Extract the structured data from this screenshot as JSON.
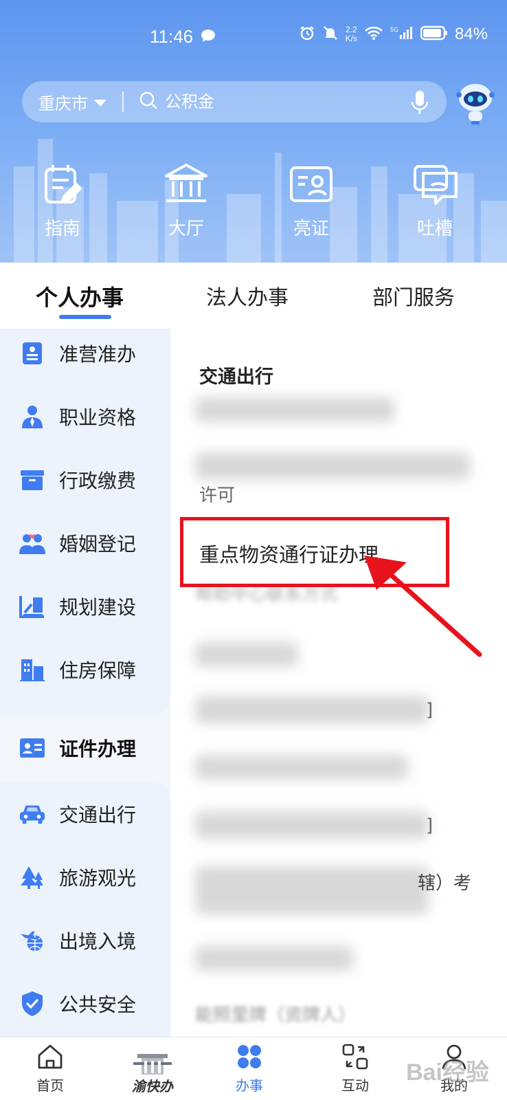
{
  "status_bar": {
    "time": "11:46",
    "net_speed_top": "2.2",
    "net_speed_unit": "K/s",
    "signal": "5G",
    "battery": "84%"
  },
  "search": {
    "city": "重庆市",
    "placeholder": "公积金"
  },
  "quick_actions": [
    {
      "label": "指南",
      "icon": "guide-icon"
    },
    {
      "label": "大厅",
      "icon": "hall-icon"
    },
    {
      "label": "亮证",
      "icon": "id-card-icon"
    },
    {
      "label": "吐槽",
      "icon": "feedback-icon"
    }
  ],
  "tabs": [
    {
      "label": "个人办事",
      "active": true
    },
    {
      "label": "法人办事",
      "active": false
    },
    {
      "label": "部门服务",
      "active": false
    }
  ],
  "left_nav": [
    {
      "label": "准营准办",
      "icon": "license-icon"
    },
    {
      "label": "职业资格",
      "icon": "professional-icon"
    },
    {
      "label": "行政缴费",
      "icon": "payment-box-icon"
    },
    {
      "label": "婚姻登记",
      "icon": "marriage-icon"
    },
    {
      "label": "规划建设",
      "icon": "planning-icon"
    },
    {
      "label": "住房保障",
      "icon": "housing-icon"
    },
    {
      "label": "证件办理",
      "icon": "certificate-icon",
      "active": true
    },
    {
      "label": "交通出行",
      "icon": "car-icon"
    },
    {
      "label": "旅游观光",
      "icon": "tree-icon"
    },
    {
      "label": "出境入境",
      "icon": "plane-globe-icon"
    },
    {
      "label": "公共安全",
      "icon": "shield-icon"
    }
  ],
  "content": {
    "category_title": "交通出行",
    "visible_fragments": [
      "许可",
      "帮助中心联系方式",
      "]",
      "]",
      "辖）考",
      "能照里牌（资牌人）"
    ],
    "highlighted_service": "重点物资通行证办理"
  },
  "bottom_nav": [
    {
      "label": "首页",
      "icon": "home-icon"
    },
    {
      "label": "渝快办",
      "icon": "yukuaiban-logo"
    },
    {
      "label": "办事",
      "icon": "grid-icon",
      "active": true
    },
    {
      "label": "互动",
      "icon": "interaction-icon"
    },
    {
      "label": "我的",
      "icon": "user-icon"
    }
  ],
  "watermark": "Bai经验",
  "colors": {
    "accent": "#3f7cf0",
    "highlight_red": "#e8121c",
    "header_blue": "#5d95ef"
  }
}
